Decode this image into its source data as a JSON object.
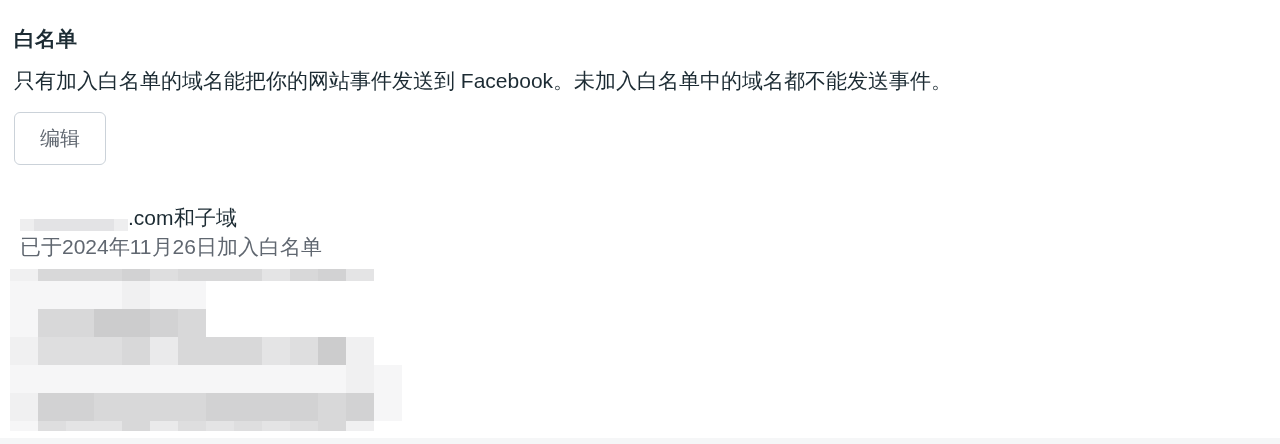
{
  "section": {
    "title": "白名单",
    "description": "只有加入白名单的域名能把你的网站事件发送到 Facebook。未加入白名单中的域名都不能发送事件。"
  },
  "edit_button": {
    "label": "编辑"
  },
  "domains": [
    {
      "name_suffix": ".com和子域",
      "added": "已于2024年11月26日加入白名单"
    }
  ]
}
